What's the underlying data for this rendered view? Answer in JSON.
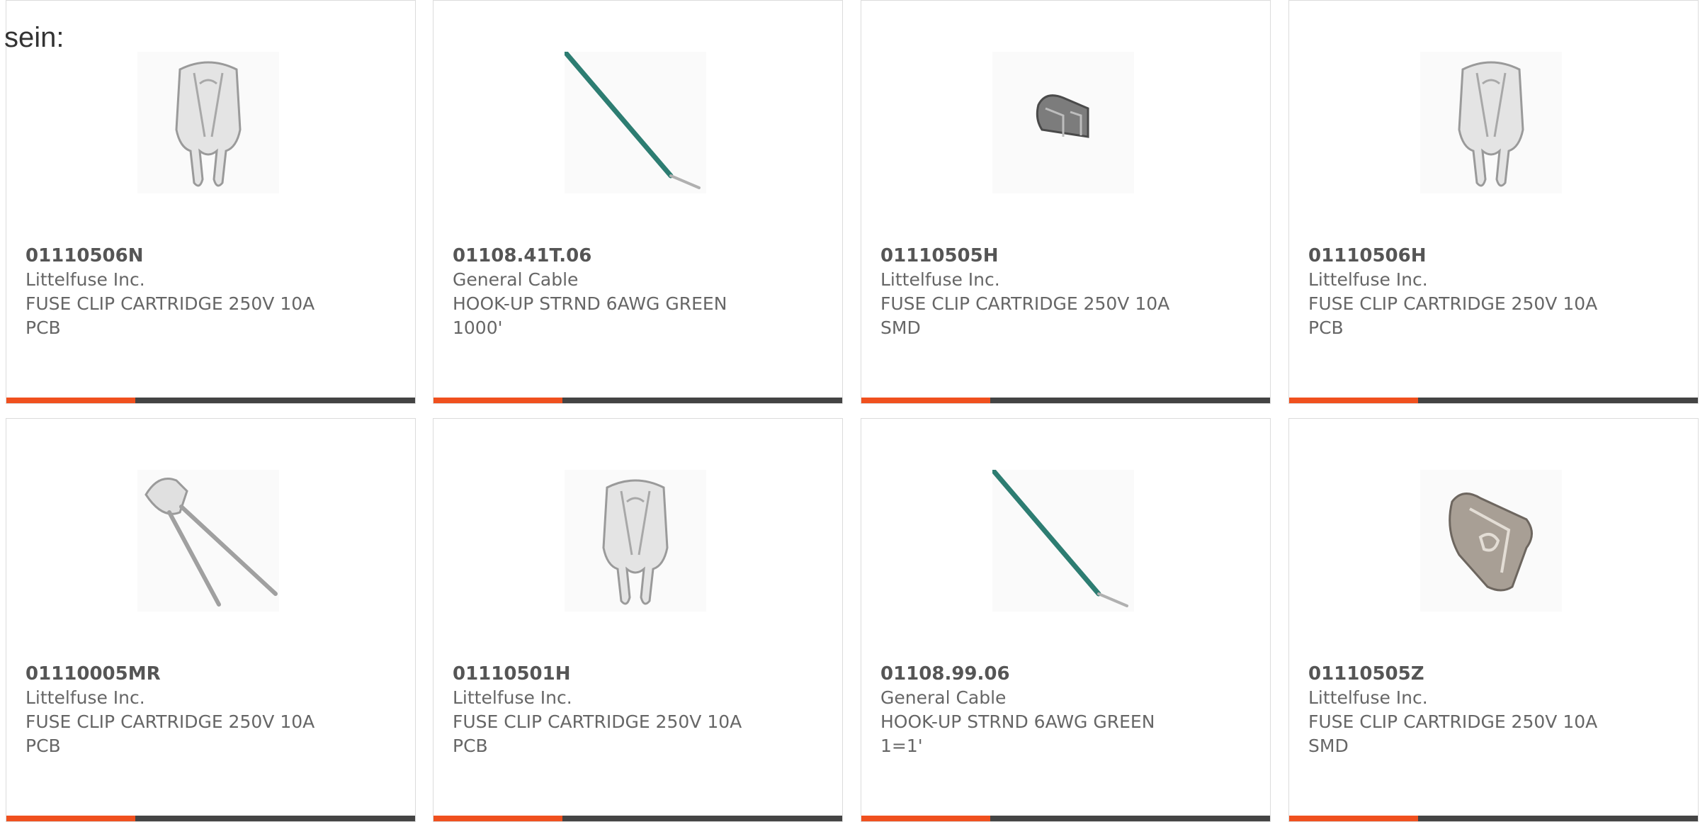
{
  "intro_text": "sein:",
  "colors": {
    "accent": "#f0501e",
    "bar": "#444444"
  },
  "products": [
    {
      "part_number": "01110506N",
      "manufacturer": "Littelfuse Inc.",
      "description_line1": "FUSE CLIP CARTRIDGE 250V 10A",
      "description_line2": "PCB",
      "image": "fuse-clip-tall-icon"
    },
    {
      "part_number": "01108.41T.06",
      "manufacturer": "General Cable",
      "description_line1": "HOOK-UP STRND 6AWG GREEN",
      "description_line2": "1000'",
      "image": "green-wire-icon"
    },
    {
      "part_number": "01110505H",
      "manufacturer": "Littelfuse Inc.",
      "description_line1": "FUSE CLIP CARTRIDGE 250V 10A",
      "description_line2": "SMD",
      "image": "fuse-clip-smd-small-icon"
    },
    {
      "part_number": "01110506H",
      "manufacturer": "Littelfuse Inc.",
      "description_line1": "FUSE CLIP CARTRIDGE 250V 10A",
      "description_line2": "PCB",
      "image": "fuse-clip-tall-icon"
    },
    {
      "part_number": "01110005MR",
      "manufacturer": "Littelfuse Inc.",
      "description_line1": "FUSE CLIP CARTRIDGE 250V 10A",
      "description_line2": "PCB",
      "image": "fuse-clip-long-leads-icon"
    },
    {
      "part_number": "01110501H",
      "manufacturer": "Littelfuse Inc.",
      "description_line1": "FUSE CLIP CARTRIDGE 250V 10A",
      "description_line2": "PCB",
      "image": "fuse-clip-tall-icon"
    },
    {
      "part_number": "01108.99.06",
      "manufacturer": "General Cable",
      "description_line1": "HOOK-UP STRND 6AWG GREEN",
      "description_line2": "1=1'",
      "image": "green-wire-icon"
    },
    {
      "part_number": "01110505Z",
      "manufacturer": "Littelfuse Inc.",
      "description_line1": "FUSE CLIP CARTRIDGE 250V 10A",
      "description_line2": "SMD",
      "image": "fuse-clip-smd-icon"
    }
  ]
}
